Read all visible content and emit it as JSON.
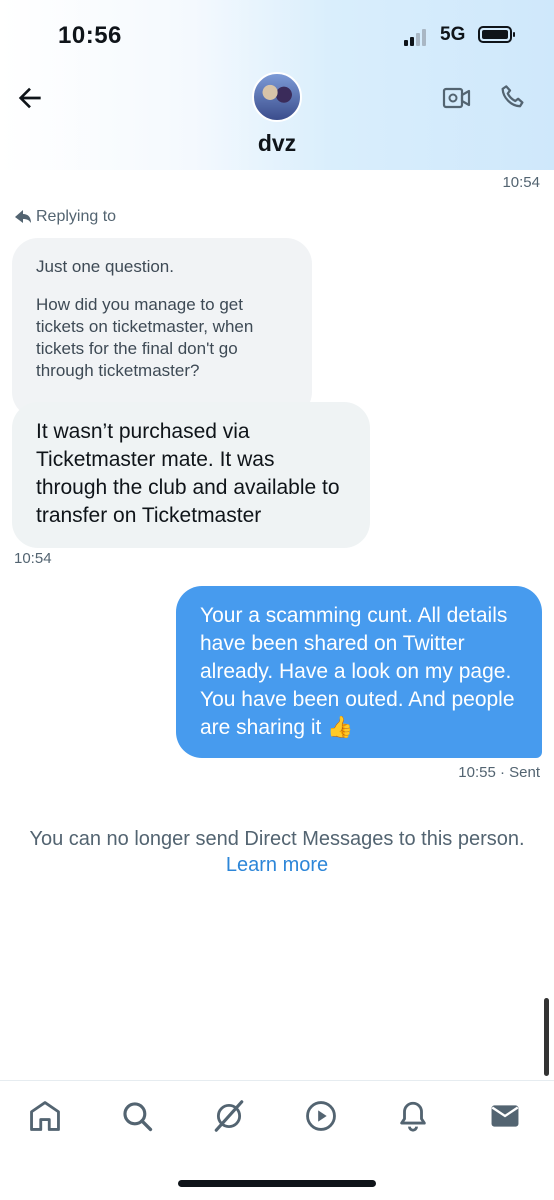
{
  "status_bar": {
    "time": "10:56",
    "network": "5G"
  },
  "header": {
    "name": "dvz"
  },
  "conversation": {
    "top_timestamp": "10:54",
    "replying_label": "Replying to",
    "quoted_message": {
      "line1": "Just one question.",
      "line2": "How did you manage to get tickets on ticketmaster, when tickets for the final don't go through ticketmaster?"
    },
    "received_message": {
      "text": "It wasn’t purchased via Ticketmaster mate. It was through the club and available to transfer on Ticketmaster",
      "time": "10:54"
    },
    "sent_message": {
      "text": "Your a scamming cunt. All details have been shared on Twitter already. Have a look on my page. You have been outed. And people are sharing it 👍",
      "time": "10:55 · Sent"
    },
    "closed_notice": "You can no longer send Direct Messages to this person.",
    "learn_more": "Learn more"
  },
  "bottom_nav": [
    "home-icon",
    "search-icon",
    "grok-icon",
    "play-icon",
    "bell-icon",
    "mail-icon"
  ],
  "colors": {
    "accent": "#1d9bf0",
    "sent_bubble": "#479bee",
    "link": "#2d86d8"
  }
}
